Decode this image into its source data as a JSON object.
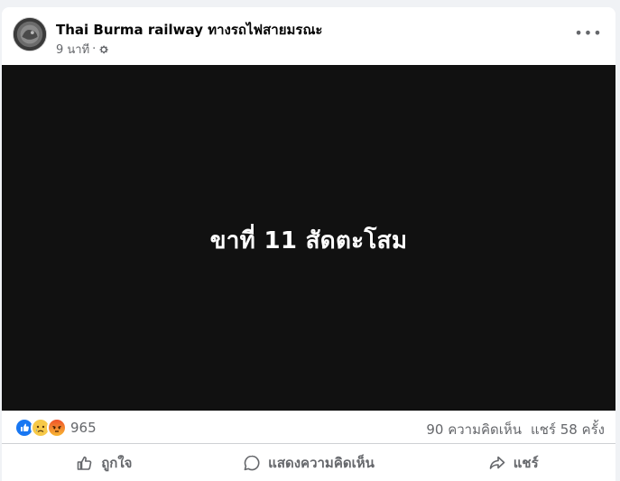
{
  "post": {
    "page_name": "Thai Burma railway ทางรถไฟสายมรณะ",
    "time": "9 นาที",
    "separator": "·",
    "privacy_icon": "gear-icon",
    "more_icon": "more-options-icon",
    "more_label": "•••"
  },
  "media": {
    "caption": "ขาที่ 11 สัดตะโสม",
    "background": "#111111"
  },
  "stats": {
    "reactions": [
      "like-reaction-icon",
      "sad-reaction-icon",
      "angry-reaction-icon"
    ],
    "reaction_count": "965",
    "comments": "90 ความคิดเห็น",
    "shares": "แชร์ 58 ครั้ง"
  },
  "actions": {
    "like": "ถูกใจ",
    "comment": "แสดงความคิดเห็น",
    "share": "แชร์"
  },
  "colors": {
    "secondary_text": "#65676b",
    "like_blue": "#1877f2",
    "angry_orange": "#f0532a",
    "sad_yellow": "#f7c948"
  }
}
